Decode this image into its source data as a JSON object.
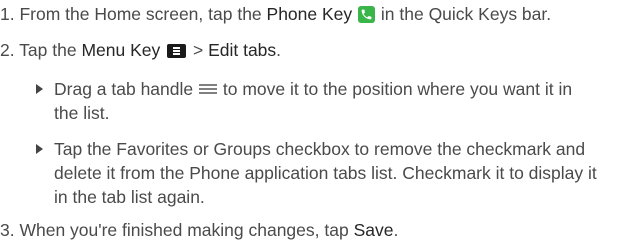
{
  "steps": [
    {
      "num": "1.",
      "pre": " From the Home screen, tap the ",
      "key": "Phone Key",
      "post": " in the Quick Keys bar.",
      "icon": "phone-key-icon"
    },
    {
      "num": "2.",
      "pre": " Tap the ",
      "key": "Menu Key",
      "sep": " > ",
      "action": "Edit tabs",
      "post": ".",
      "icon": "menu-key-icon"
    },
    {
      "num": "3.",
      "pre": " When you're finished making changes, tap ",
      "action": "Save",
      "post": "."
    }
  ],
  "bullets": [
    {
      "line1_pre": "Drag a tab handle ",
      "line1_post": " to move it to the position where you want it in",
      "line2": "the list.",
      "icon": "tab-handle-icon"
    },
    {
      "line1": "Tap the Favorites or Groups checkbox to remove the checkmark and",
      "line2": "delete it from the Phone application tabs list. Checkmark it to display it",
      "line3": "in the tab list again."
    }
  ],
  "colors": {
    "text": "#4a4a4a",
    "phone_key_green": "#39b54a",
    "menu_key_black": "#1a1a1a"
  }
}
